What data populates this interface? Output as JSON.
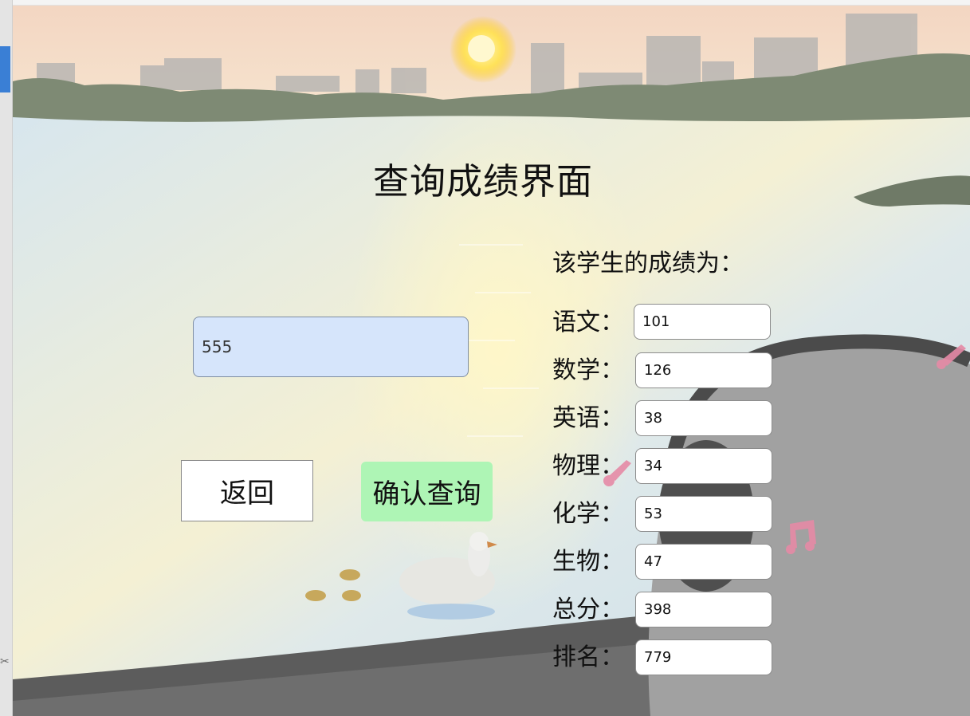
{
  "window": {
    "title": "查询成绩界面"
  },
  "query": {
    "student_id_value": "555",
    "back_label": "返回",
    "confirm_label": "确认查询"
  },
  "results": {
    "heading": "该学生的成绩为：",
    "rows": [
      {
        "label": "语文：",
        "value": "101"
      },
      {
        "label": "数学：",
        "value": "126"
      },
      {
        "label": "英语：",
        "value": "38"
      },
      {
        "label": "物理：",
        "value": "34"
      },
      {
        "label": "化学：",
        "value": "53"
      },
      {
        "label": "生物：",
        "value": "47"
      },
      {
        "label": "总分：",
        "value": "398"
      },
      {
        "label": "排名：",
        "value": "779"
      }
    ]
  },
  "colors": {
    "input_bg": "#d6e5fb",
    "confirm_button_bg": "#aef5b5",
    "accent_tab": "#3a7fd5"
  }
}
